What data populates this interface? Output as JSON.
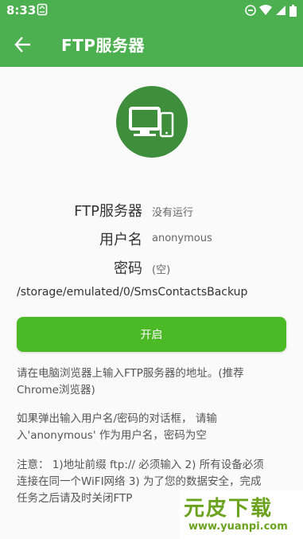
{
  "status_bar": {
    "time": "8:33"
  },
  "app_bar": {
    "title": "FTP服务器"
  },
  "server": {
    "label": "FTP服务器",
    "status": "没有运行",
    "user_label": "用户名",
    "user_value": "anonymous",
    "password_label": "密码",
    "password_value": "(空)",
    "path": "/storage/emulated/0/SmsContactsBackup"
  },
  "start_button": "开启",
  "instructions": {
    "p1_line1": "请在电脑浏览器上输入FTP服务器的地址。(推荐",
    "p1_line2": "Chrome浏览器)",
    "p2_line1": "如果弹出输入用户名/密码的对话框， 请输",
    "p2_line2": "入'anonymous' 作为用户名，密码为空",
    "p3_line1": "注意： 1)地址前缀 ftp:// 必须输入 2) 所有设备必须",
    "p3_line2": "连接在同一个WiFI网络 3) 为了您的数据安全，完成",
    "p3_line3": "任务之后请及时关闭FTP"
  },
  "watermark": {
    "main": "元皮下载",
    "sub": "www.yuanpi.com"
  },
  "colors": {
    "primary": "#4CAF50",
    "button": "#4CBA27",
    "hero": "#3E8E3B"
  }
}
